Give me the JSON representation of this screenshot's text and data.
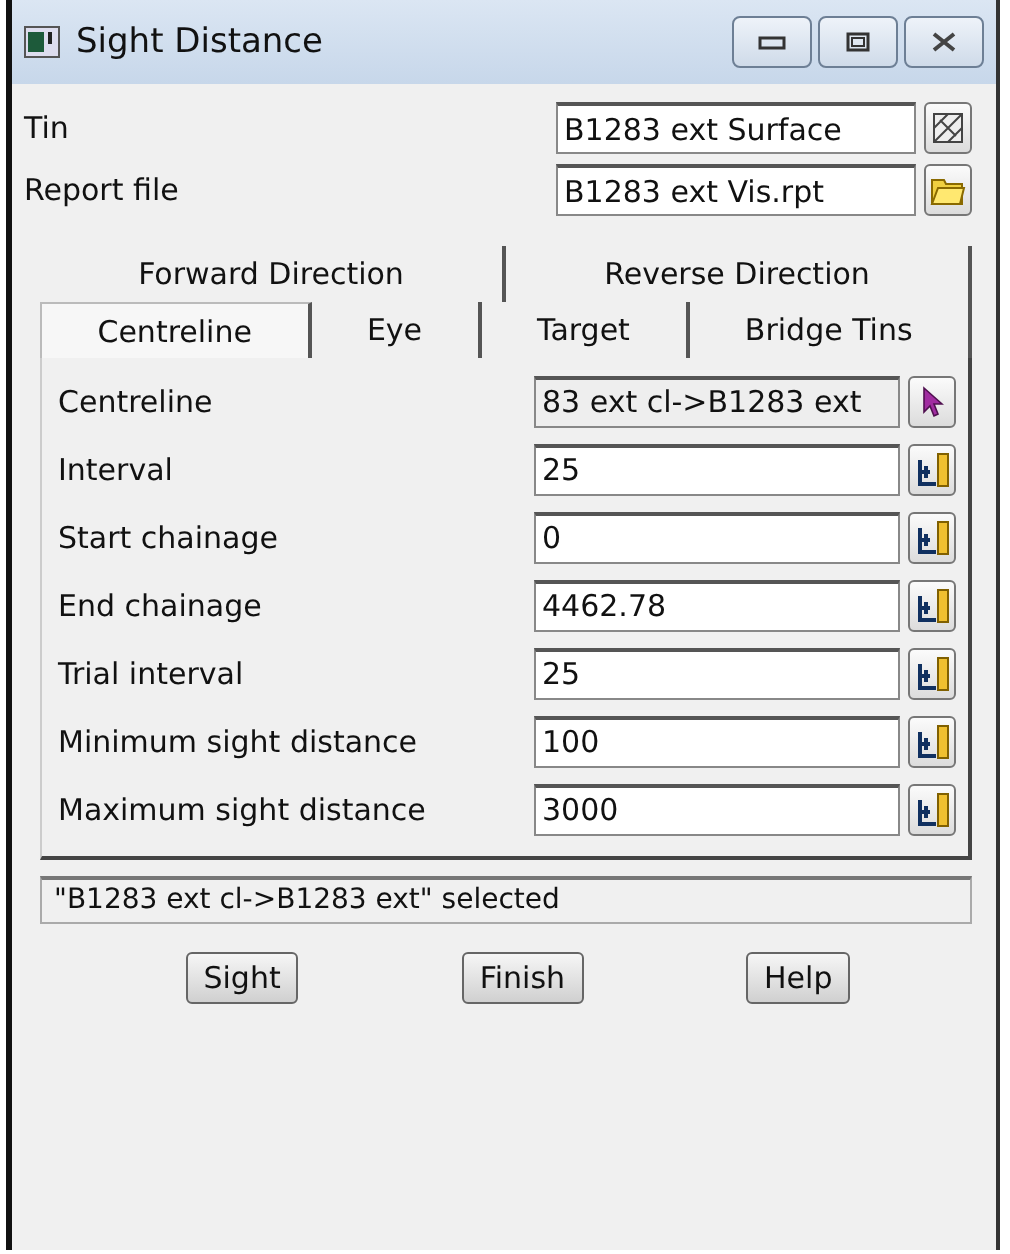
{
  "window": {
    "title": "Sight Distance"
  },
  "top_fields": [
    {
      "label": "Tin",
      "value": "B1283 ext Surface",
      "kind": "tin"
    },
    {
      "label": "Report file",
      "value": "B1283 ext Vis.rpt",
      "kind": "file"
    }
  ],
  "tab_rows": [
    [
      {
        "label": "Forward Direction",
        "selected": false
      },
      {
        "label": "Reverse Direction",
        "selected": false
      }
    ],
    [
      {
        "label": "Centreline",
        "selected": true
      },
      {
        "label": "Eye",
        "selected": false
      },
      {
        "label": "Target",
        "selected": false
      },
      {
        "label": "Bridge Tins",
        "selected": false
      }
    ]
  ],
  "fields": [
    {
      "label": "Centreline",
      "value": "83 ext cl->B1283 ext",
      "kind": "pick"
    },
    {
      "label": "Interval",
      "value": "25",
      "kind": "value"
    },
    {
      "label": "Start chainage",
      "value": "0",
      "kind": "value"
    },
    {
      "label": "End chainage",
      "value": "4462.78",
      "kind": "value"
    },
    {
      "label": "Trial interval",
      "value": "25",
      "kind": "value"
    },
    {
      "label": "Minimum sight distance",
      "value": "100",
      "kind": "value"
    },
    {
      "label": "Maximum sight distance",
      "value": "3000",
      "kind": "value"
    }
  ],
  "status": "\"B1283 ext cl->B1283 ext\" selected",
  "buttons": [
    "Sight",
    "Finish",
    "Help"
  ]
}
